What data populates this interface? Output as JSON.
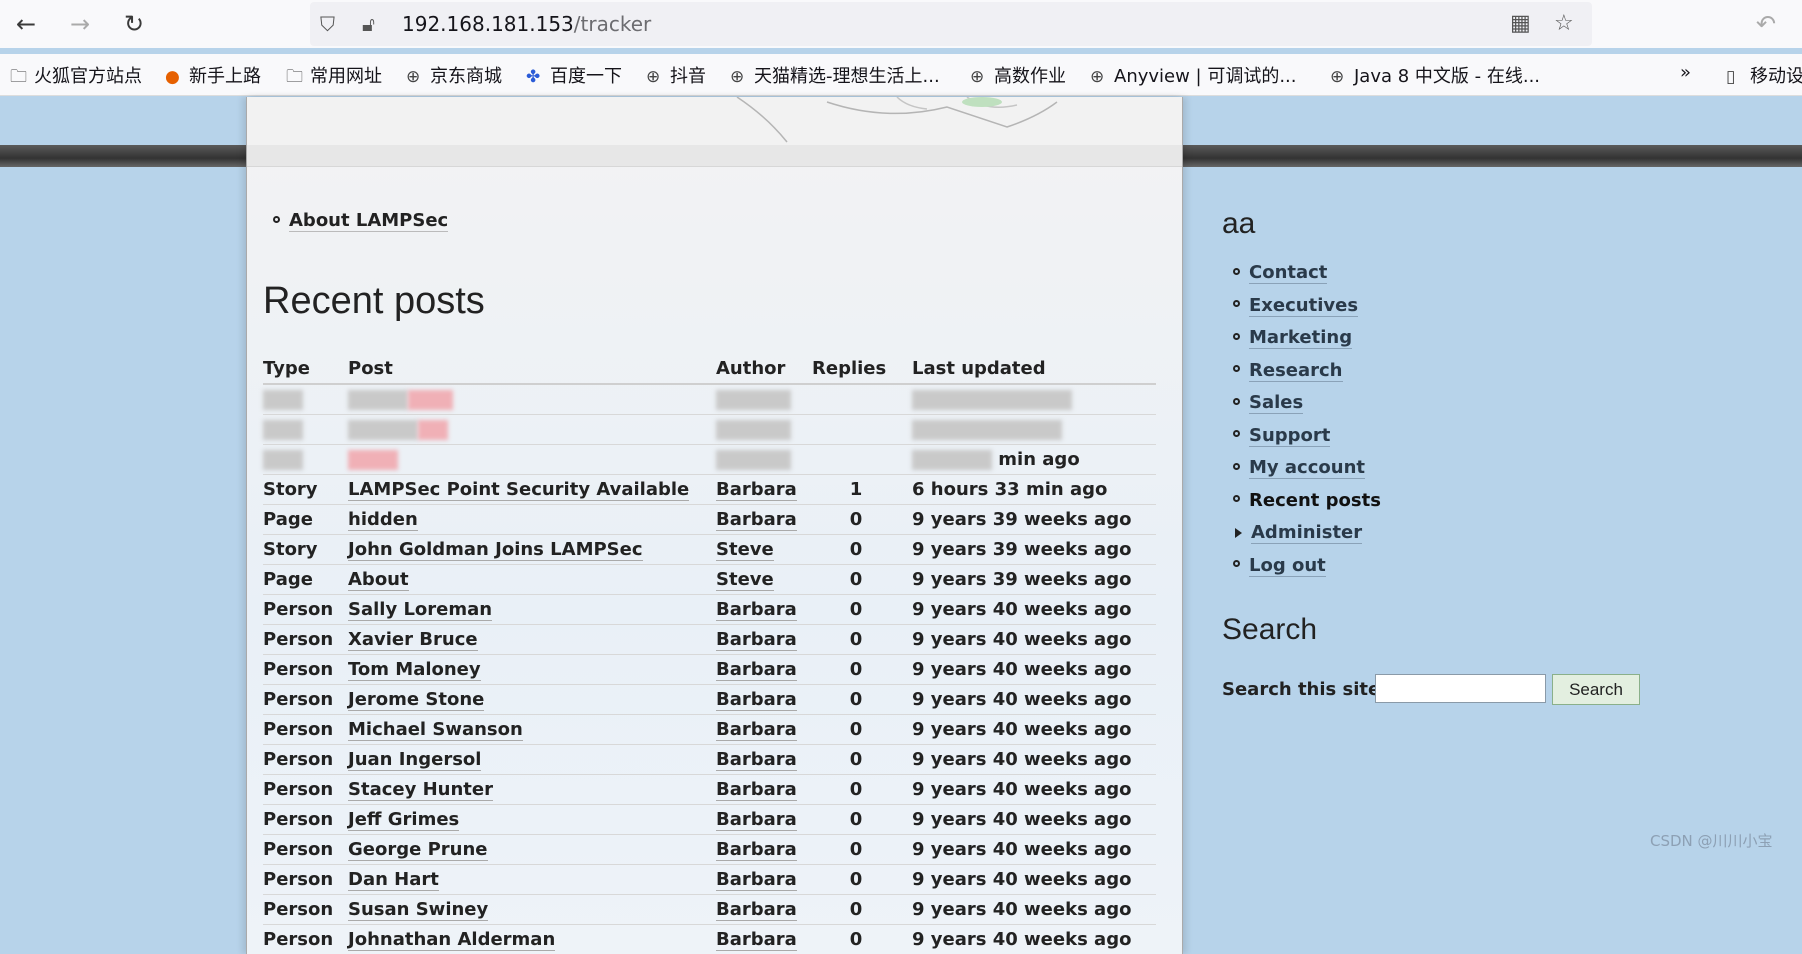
{
  "browser": {
    "url_host": "192.168.181.153",
    "url_path": "/tracker",
    "bookmarks": [
      "火狐官方站点",
      "新手上路",
      "常用网址",
      "京东商城",
      "百度一下",
      "抖音",
      "天猫精选-理想生活上...",
      "高数作业",
      "Anyview | 可调试的...",
      "Java 8 中文版 - 在线...",
      "移动设"
    ],
    "icons": {
      "back": "back-arrow-icon",
      "forward": "forward-arrow-icon",
      "reload": "reload-icon",
      "shield": "shield-icon",
      "insecure": "insecure-lock-icon",
      "qr": "qr-code-icon",
      "star": "bookmark-star-icon",
      "undo": "undo-icon"
    }
  },
  "main": {
    "nav_link": "About LAMPSec",
    "heading": "Recent posts",
    "table": {
      "headers": [
        "Type",
        "Post",
        "Author",
        "Replies",
        "Last updated"
      ],
      "rows": [
        [
          "Story",
          "LAMPSec Point Security Available",
          "Barbara",
          "1",
          "6 hours 33 min ago"
        ],
        [
          "Page",
          "hidden",
          "Barbara",
          "0",
          "9 years 39 weeks ago"
        ],
        [
          "Story",
          "John Goldman Joins LAMPSec",
          "Steve",
          "0",
          "9 years 39 weeks ago"
        ],
        [
          "Page",
          "About",
          "Steve",
          "0",
          "9 years 39 weeks ago"
        ],
        [
          "Person",
          "Sally Loreman",
          "Barbara",
          "0",
          "9 years 40 weeks ago"
        ],
        [
          "Person",
          "Xavier Bruce",
          "Barbara",
          "0",
          "9 years 40 weeks ago"
        ],
        [
          "Person",
          "Tom Maloney",
          "Barbara",
          "0",
          "9 years 40 weeks ago"
        ],
        [
          "Person",
          "Jerome Stone",
          "Barbara",
          "0",
          "9 years 40 weeks ago"
        ],
        [
          "Person",
          "Michael Swanson",
          "Barbara",
          "0",
          "9 years 40 weeks ago"
        ],
        [
          "Person",
          "Juan Ingersol",
          "Barbara",
          "0",
          "9 years 40 weeks ago"
        ],
        [
          "Person",
          "Stacey Hunter",
          "Barbara",
          "0",
          "9 years 40 weeks ago"
        ],
        [
          "Person",
          "Jeff Grimes",
          "Barbara",
          "0",
          "9 years 40 weeks ago"
        ],
        [
          "Person",
          "George Prune",
          "Barbara",
          "0",
          "9 years 40 weeks ago"
        ],
        [
          "Person",
          "Dan Hart",
          "Barbara",
          "0",
          "9 years 40 weeks ago"
        ],
        [
          "Person",
          "Susan Swiney",
          "Barbara",
          "0",
          "9 years 40 weeks ago"
        ],
        [
          "Person",
          "Johnathan Alderman",
          "Barbara",
          "0",
          "9 years 40 weeks ago"
        ]
      ],
      "partial_visible_text": "min ago"
    }
  },
  "sidebar": {
    "title": "aa",
    "items": [
      {
        "label": "Contact",
        "active": false
      },
      {
        "label": "Executives",
        "active": false
      },
      {
        "label": "Marketing",
        "active": false
      },
      {
        "label": "Research",
        "active": false
      },
      {
        "label": "Sales",
        "active": false
      },
      {
        "label": "Support",
        "active": false
      },
      {
        "label": "My account",
        "active": false
      },
      {
        "label": "Recent posts",
        "active": true
      },
      {
        "label": "Administer",
        "active": false,
        "collapsed": true
      },
      {
        "label": "Log out",
        "active": false
      }
    ],
    "search": {
      "title": "Search",
      "label": "Search this site:",
      "value": "",
      "button": "Search"
    }
  },
  "watermark": "CSDN @川川小宝",
  "colors": {
    "page_background": "#b7d3ea",
    "search_button": "#e3efe0"
  }
}
